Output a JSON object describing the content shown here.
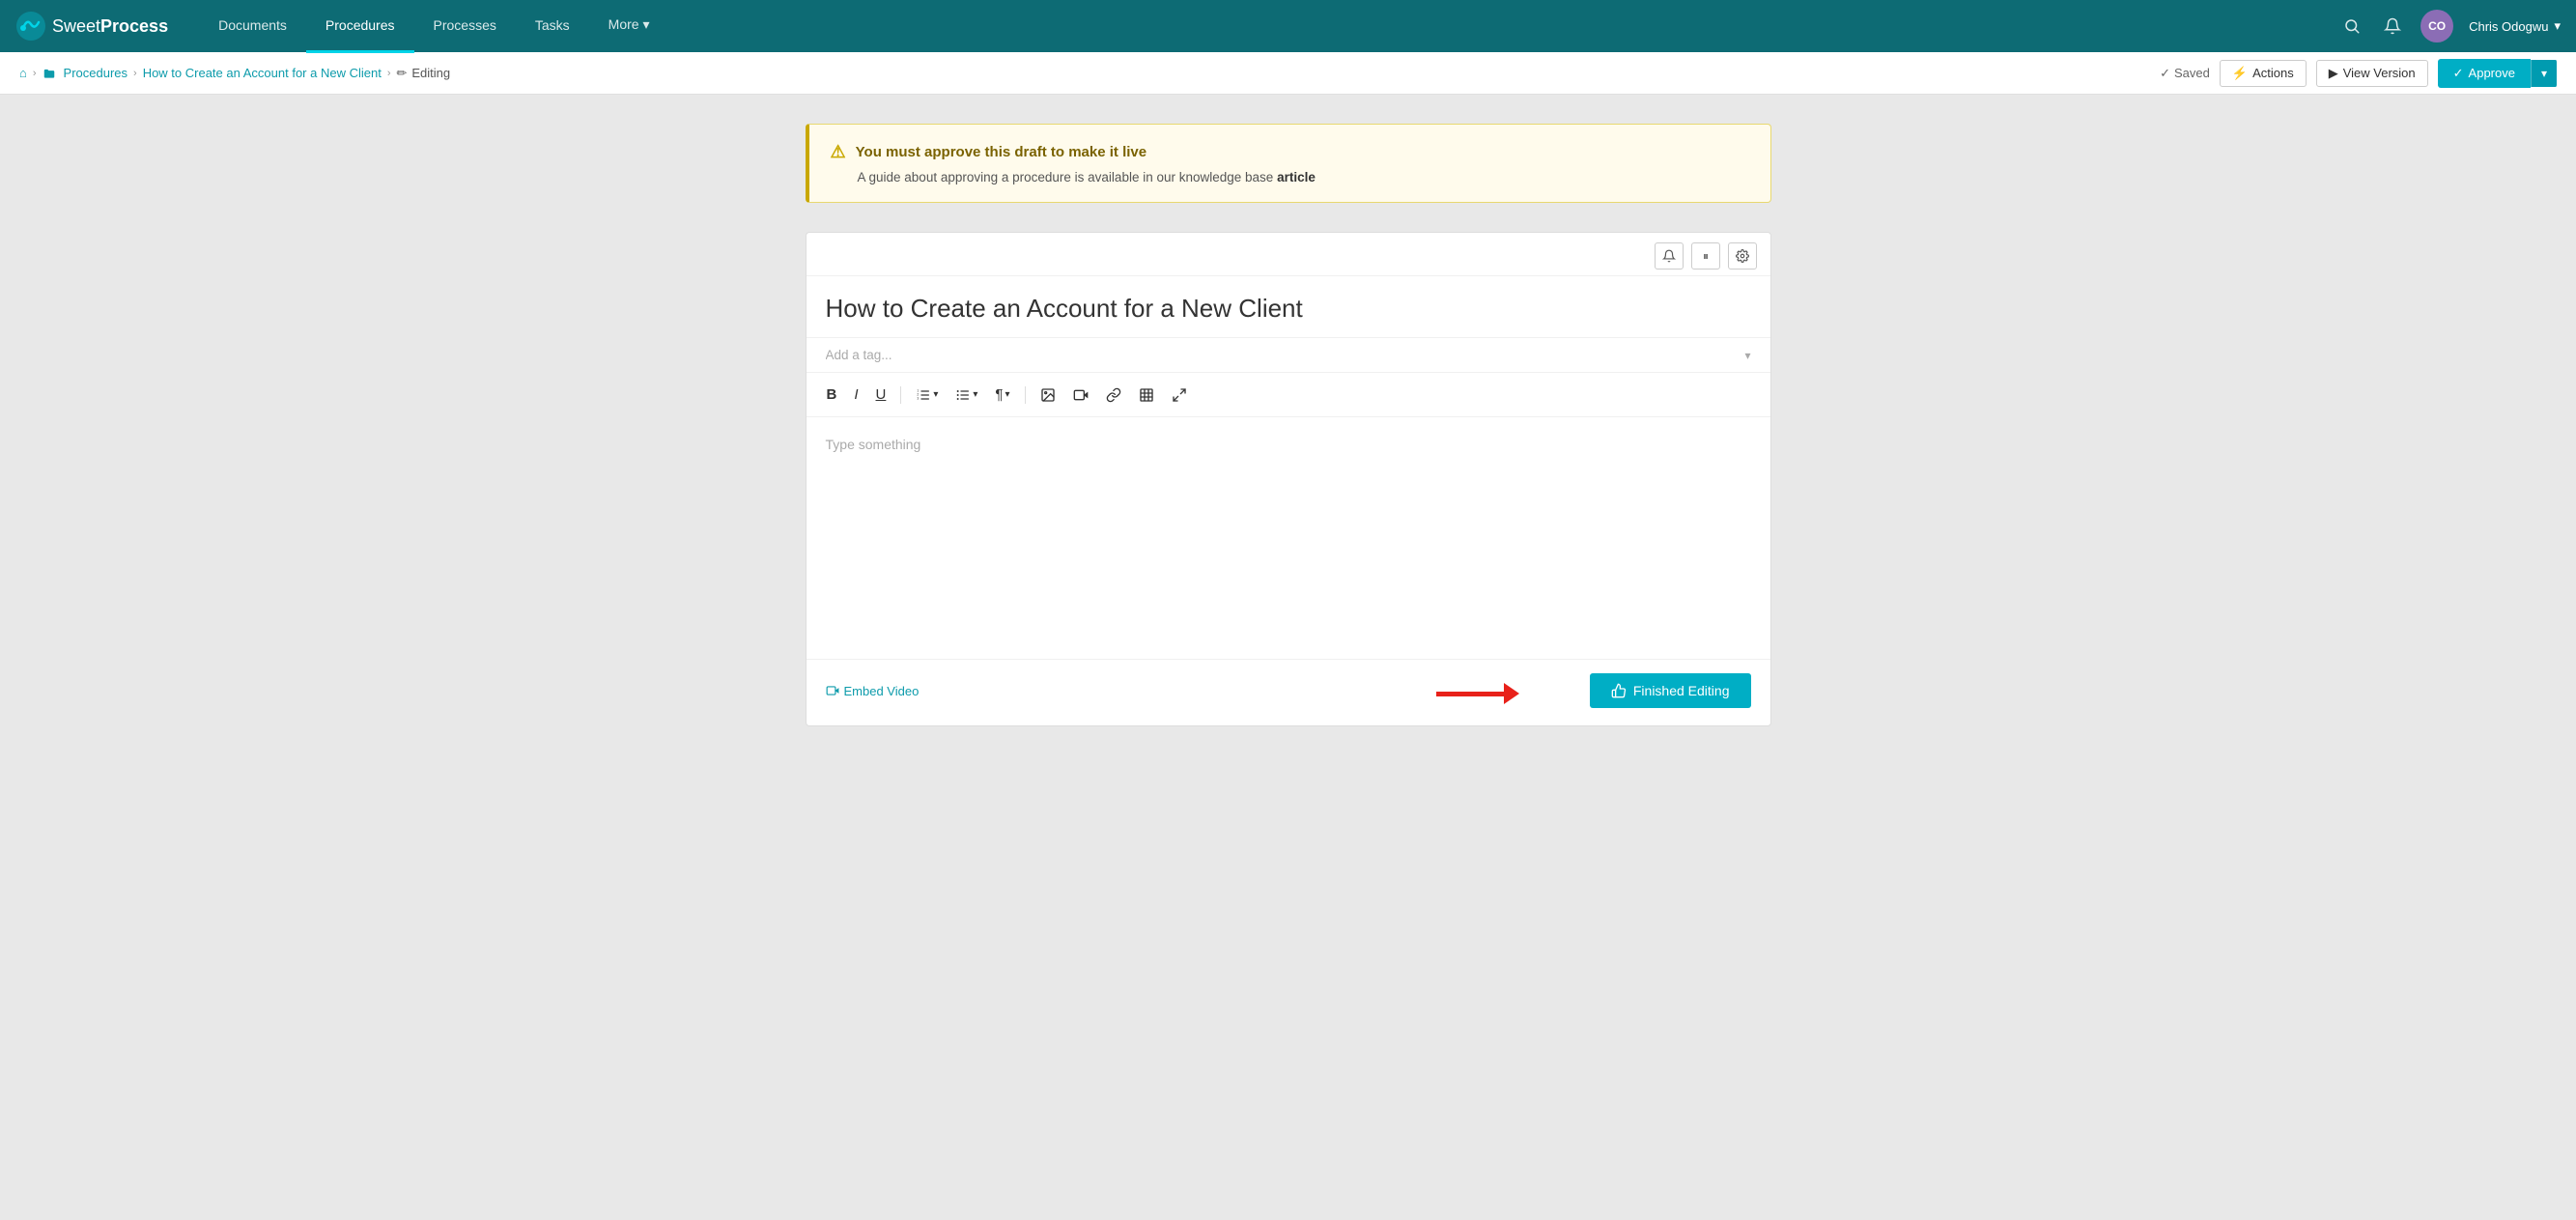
{
  "brand": {
    "name_sweet": "Sweet",
    "name_process": "Process"
  },
  "navbar": {
    "links": [
      {
        "label": "Documents",
        "active": false
      },
      {
        "label": "Procedures",
        "active": true
      },
      {
        "label": "Processes",
        "active": false
      },
      {
        "label": "Tasks",
        "active": false
      },
      {
        "label": "More",
        "active": false,
        "has_dropdown": true
      }
    ],
    "search_icon": "🔍",
    "bell_icon": "🔔",
    "user_initials": "CO",
    "user_name": "Chris Odogwu"
  },
  "breadcrumb": {
    "home_icon": "⌂",
    "procedures_label": "Procedures",
    "page_label": "How to Create an Account for a New Client",
    "editing_label": "Editing",
    "editing_icon": "✏"
  },
  "breadcrumb_actions": {
    "saved_label": "Saved",
    "saved_check": "✓",
    "actions_icon": "⚡",
    "actions_label": "Actions",
    "view_version_icon": "▶",
    "view_version_label": "View Version",
    "approve_check": "✓",
    "approve_label": "Approve"
  },
  "alert": {
    "icon": "⚠",
    "title": "You must approve this draft to make it live",
    "body_text": "A guide about approving a procedure is available in our knowledge base ",
    "link_text": "article"
  },
  "editor": {
    "toolbar_icons": {
      "bell": "🔔",
      "pause": "⏸",
      "settings": "⚙"
    },
    "title_placeholder": "How to Create an Account for a New Client",
    "title_value": "How to Create an Account for a New Client",
    "tag_placeholder": "Add a tag...",
    "format_buttons": [
      {
        "label": "B",
        "style": "bold",
        "name": "bold-btn"
      },
      {
        "label": "I",
        "style": "italic",
        "name": "italic-btn"
      },
      {
        "label": "U",
        "style": "underline",
        "name": "underline-btn"
      }
    ],
    "list_ordered_icon": "≡",
    "list_unordered_icon": "≡",
    "paragraph_icon": "¶",
    "image_icon": "🖼",
    "video_icon": "📷",
    "link_icon": "🔗",
    "table_icon": "⊞",
    "expand_icon": "⤢",
    "content_placeholder": "Type something",
    "embed_video_label": "Embed Video",
    "embed_video_icon": "📹",
    "finished_editing_icon": "👍",
    "finished_editing_label": "Finished Editing"
  }
}
